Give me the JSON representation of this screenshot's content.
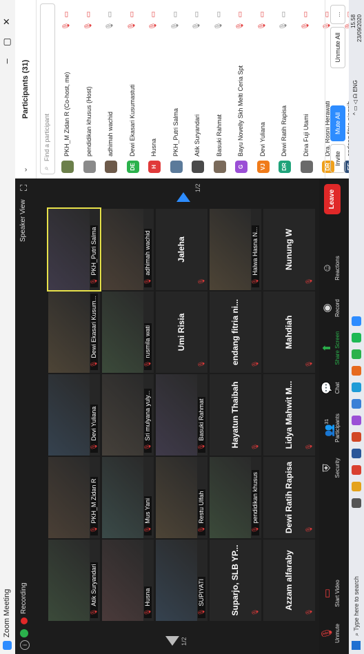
{
  "window": {
    "title": "Zoom Meeting"
  },
  "meeting": {
    "recording_label": "Recording",
    "speaker_view": "Speaker View"
  },
  "pages": {
    "left": "1/2",
    "right": "1/2"
  },
  "tiles": [
    {
      "label": "Atik Suryandari",
      "type": "video"
    },
    {
      "label": "PKH_M Zidan R",
      "type": "video"
    },
    {
      "label": "Devi Yuliana",
      "type": "video"
    },
    {
      "label": "Dewi Ekasari Kusum...",
      "type": "video"
    },
    {
      "label": "PKH_Putri Salma",
      "type": "video",
      "highlight": true
    },
    {
      "label": "Husna",
      "type": "video"
    },
    {
      "label": "Mus Yani",
      "type": "video"
    },
    {
      "label": "Sri mulyana yuly...",
      "type": "video"
    },
    {
      "label": "rusmila wati",
      "type": "video"
    },
    {
      "label": "adhimah wachid",
      "type": "video"
    },
    {
      "label": "SUPIYATI",
      "type": "video"
    },
    {
      "label": "Restu Ulfah",
      "type": "video"
    },
    {
      "label": "Basuki Rahmat",
      "type": "video"
    },
    {
      "label": "Umi Risia",
      "type": "name"
    },
    {
      "label": "Jaleha",
      "type": "name"
    },
    {
      "label": "Suparjo, SLB YP...",
      "type": "name"
    },
    {
      "label": "pendidikan khusus",
      "type": "video"
    },
    {
      "label": "Hayatun Thaibah",
      "type": "name"
    },
    {
      "label": "endang fitria ni...",
      "type": "name"
    },
    {
      "label": "Halwa Hasna N...",
      "type": "video"
    },
    {
      "label": "Azzam alfaraby",
      "type": "name"
    },
    {
      "label": "Dewi Ratih Rapisa",
      "type": "name"
    },
    {
      "label": "Lidya Mahwit M...",
      "type": "name"
    },
    {
      "label": "Mahdiah",
      "type": "name"
    },
    {
      "label": "Nunung W",
      "type": "name"
    }
  ],
  "toolbar": {
    "unmute": "Unmute",
    "start_video": "Start Video",
    "security": "Security",
    "participants": "Participants",
    "participants_count": "31",
    "chat": "Chat",
    "share_screen": "Share Screen",
    "record": "Record",
    "reactions": "Reactions",
    "end": "Leave"
  },
  "participants_panel": {
    "title": "Participants (31)",
    "search_placeholder": "Find a participant",
    "list": [
      {
        "name": "PKH_M Zidan R (Co-host, me)",
        "initials": "",
        "color": "#6b7f4a"
      },
      {
        "name": "pendidikan khusus (Host)",
        "initials": "",
        "color": "#8a8a8a"
      },
      {
        "name": "adhimah wachid",
        "initials": "",
        "color": "#6d5a4a"
      },
      {
        "name": "Dewi Ekasari Kusumastuti",
        "initials": "DE",
        "color": "#2bb24c"
      },
      {
        "name": "Husna",
        "initials": "H",
        "color": "#e03a3a"
      },
      {
        "name": "PKH_Putri Salma",
        "initials": "",
        "color": "#5b7a9a"
      },
      {
        "name": "Atik Suryandari",
        "initials": "",
        "color": "#4a4a4a"
      },
      {
        "name": "Basuki Rahmat",
        "initials": "",
        "color": "#7a6a5a"
      },
      {
        "name": "Bayu Novelly Skh Melti Ceria Spt",
        "initials": "G",
        "color": "#9b4fd6"
      },
      {
        "name": "Devi Yuliana",
        "initials": "VJ",
        "color": "#f07b1a"
      },
      {
        "name": "Dewi Ratih Rapisa",
        "initials": "DR",
        "color": "#1fa37a"
      },
      {
        "name": "Dina Fuji Utami",
        "initials": "",
        "color": "#6a6a6a"
      },
      {
        "name": "Dra. Rosni Herawati",
        "initials": "DR",
        "color": "#f0a01a"
      },
      {
        "name": "endang fitria ningsih",
        "initials": "EF",
        "color": "#2f4f7a"
      }
    ],
    "invite": "Invite",
    "mute_all": "Mute All",
    "unmute_all": "Unmute All",
    "more": "..."
  },
  "taskbar": {
    "search": "Type here to search",
    "lang": "ENG",
    "time": "15.58",
    "date": "23/09/2020"
  },
  "colors": {
    "accent": "#2d8cff",
    "danger": "#e02828",
    "success": "#2bb24c"
  }
}
